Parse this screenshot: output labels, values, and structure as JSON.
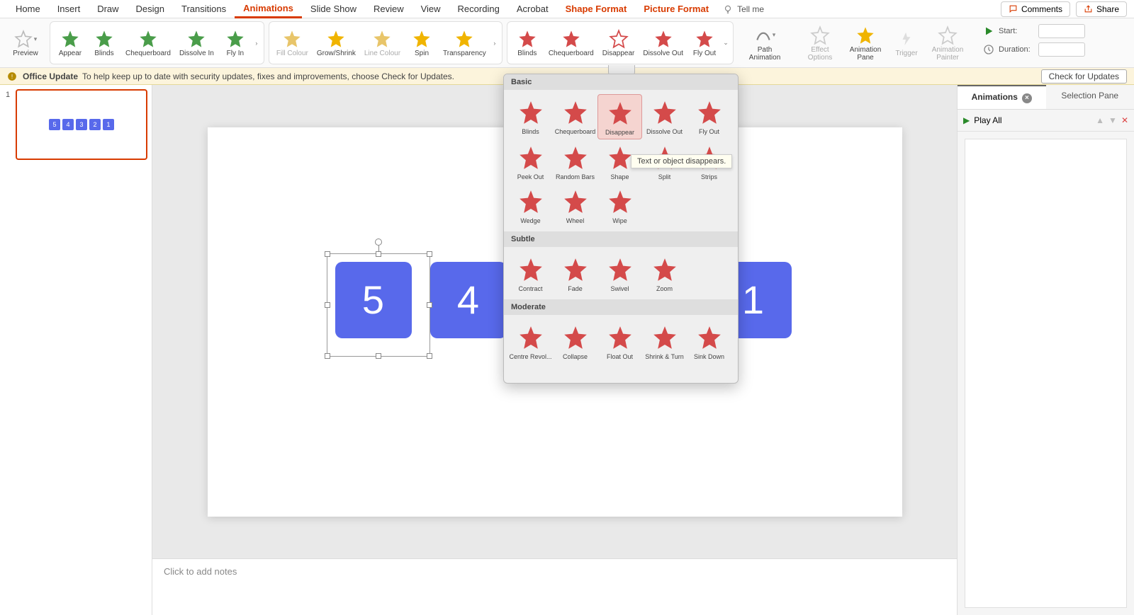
{
  "tabs": [
    "Home",
    "Insert",
    "Draw",
    "Design",
    "Transitions",
    "Animations",
    "Slide Show",
    "Review",
    "View",
    "Recording",
    "Acrobat",
    "Shape Format",
    "Picture Format"
  ],
  "active_tab": "Animations",
  "tellme": "Tell me",
  "topbuttons": {
    "comments": "Comments",
    "share": "Share"
  },
  "ribbon": {
    "preview": "Preview",
    "entrance": [
      "Appear",
      "Blinds",
      "Chequerboard",
      "Dissolve In",
      "Fly In"
    ],
    "emphasis": [
      "Fill Colour",
      "Grow/Shrink",
      "Line Colour",
      "Spin",
      "Transparency"
    ],
    "exit": [
      "Blinds",
      "Chequerboard",
      "Disappear",
      "Dissolve Out",
      "Fly Out"
    ],
    "advanced": {
      "path": "Path Animation",
      "effect": "Effect Options",
      "pane": "Animation Pane",
      "trigger": "Trigger",
      "painter": "Animation Painter"
    },
    "timing": {
      "start_label": "Start:",
      "duration_label": "Duration:"
    }
  },
  "updatebar": {
    "title": "Office Update",
    "msg": "To help keep up to date with security updates, fixes and improvements, choose Check for Updates.",
    "btn": "Check for Updates"
  },
  "thumb": {
    "num": "1",
    "boxes": [
      "5",
      "4",
      "3",
      "2",
      "1"
    ]
  },
  "slide": {
    "boxes": [
      "5",
      "4",
      "3",
      "2",
      "1"
    ]
  },
  "notes_placeholder": "Click to add notes",
  "rightpane": {
    "tab1": "Animations",
    "tab2": "Selection Pane",
    "play": "Play All"
  },
  "gallery": {
    "sections": {
      "Basic": [
        "Blinds",
        "Chequerboard",
        "Disappear",
        "Dissolve Out",
        "Fly Out",
        "Peek Out",
        "Random Bars",
        "Shape",
        "Split",
        "Strips",
        "Wedge",
        "Wheel",
        "Wipe"
      ],
      "Subtle": [
        "Contract",
        "Fade",
        "Swivel",
        "Zoom"
      ],
      "Moderate": [
        "Centre Revol...",
        "Collapse",
        "Float Out",
        "Shrink & Turn",
        "Sink Down"
      ]
    },
    "selected": "Disappear",
    "tooltip": "Text or object disappears."
  }
}
